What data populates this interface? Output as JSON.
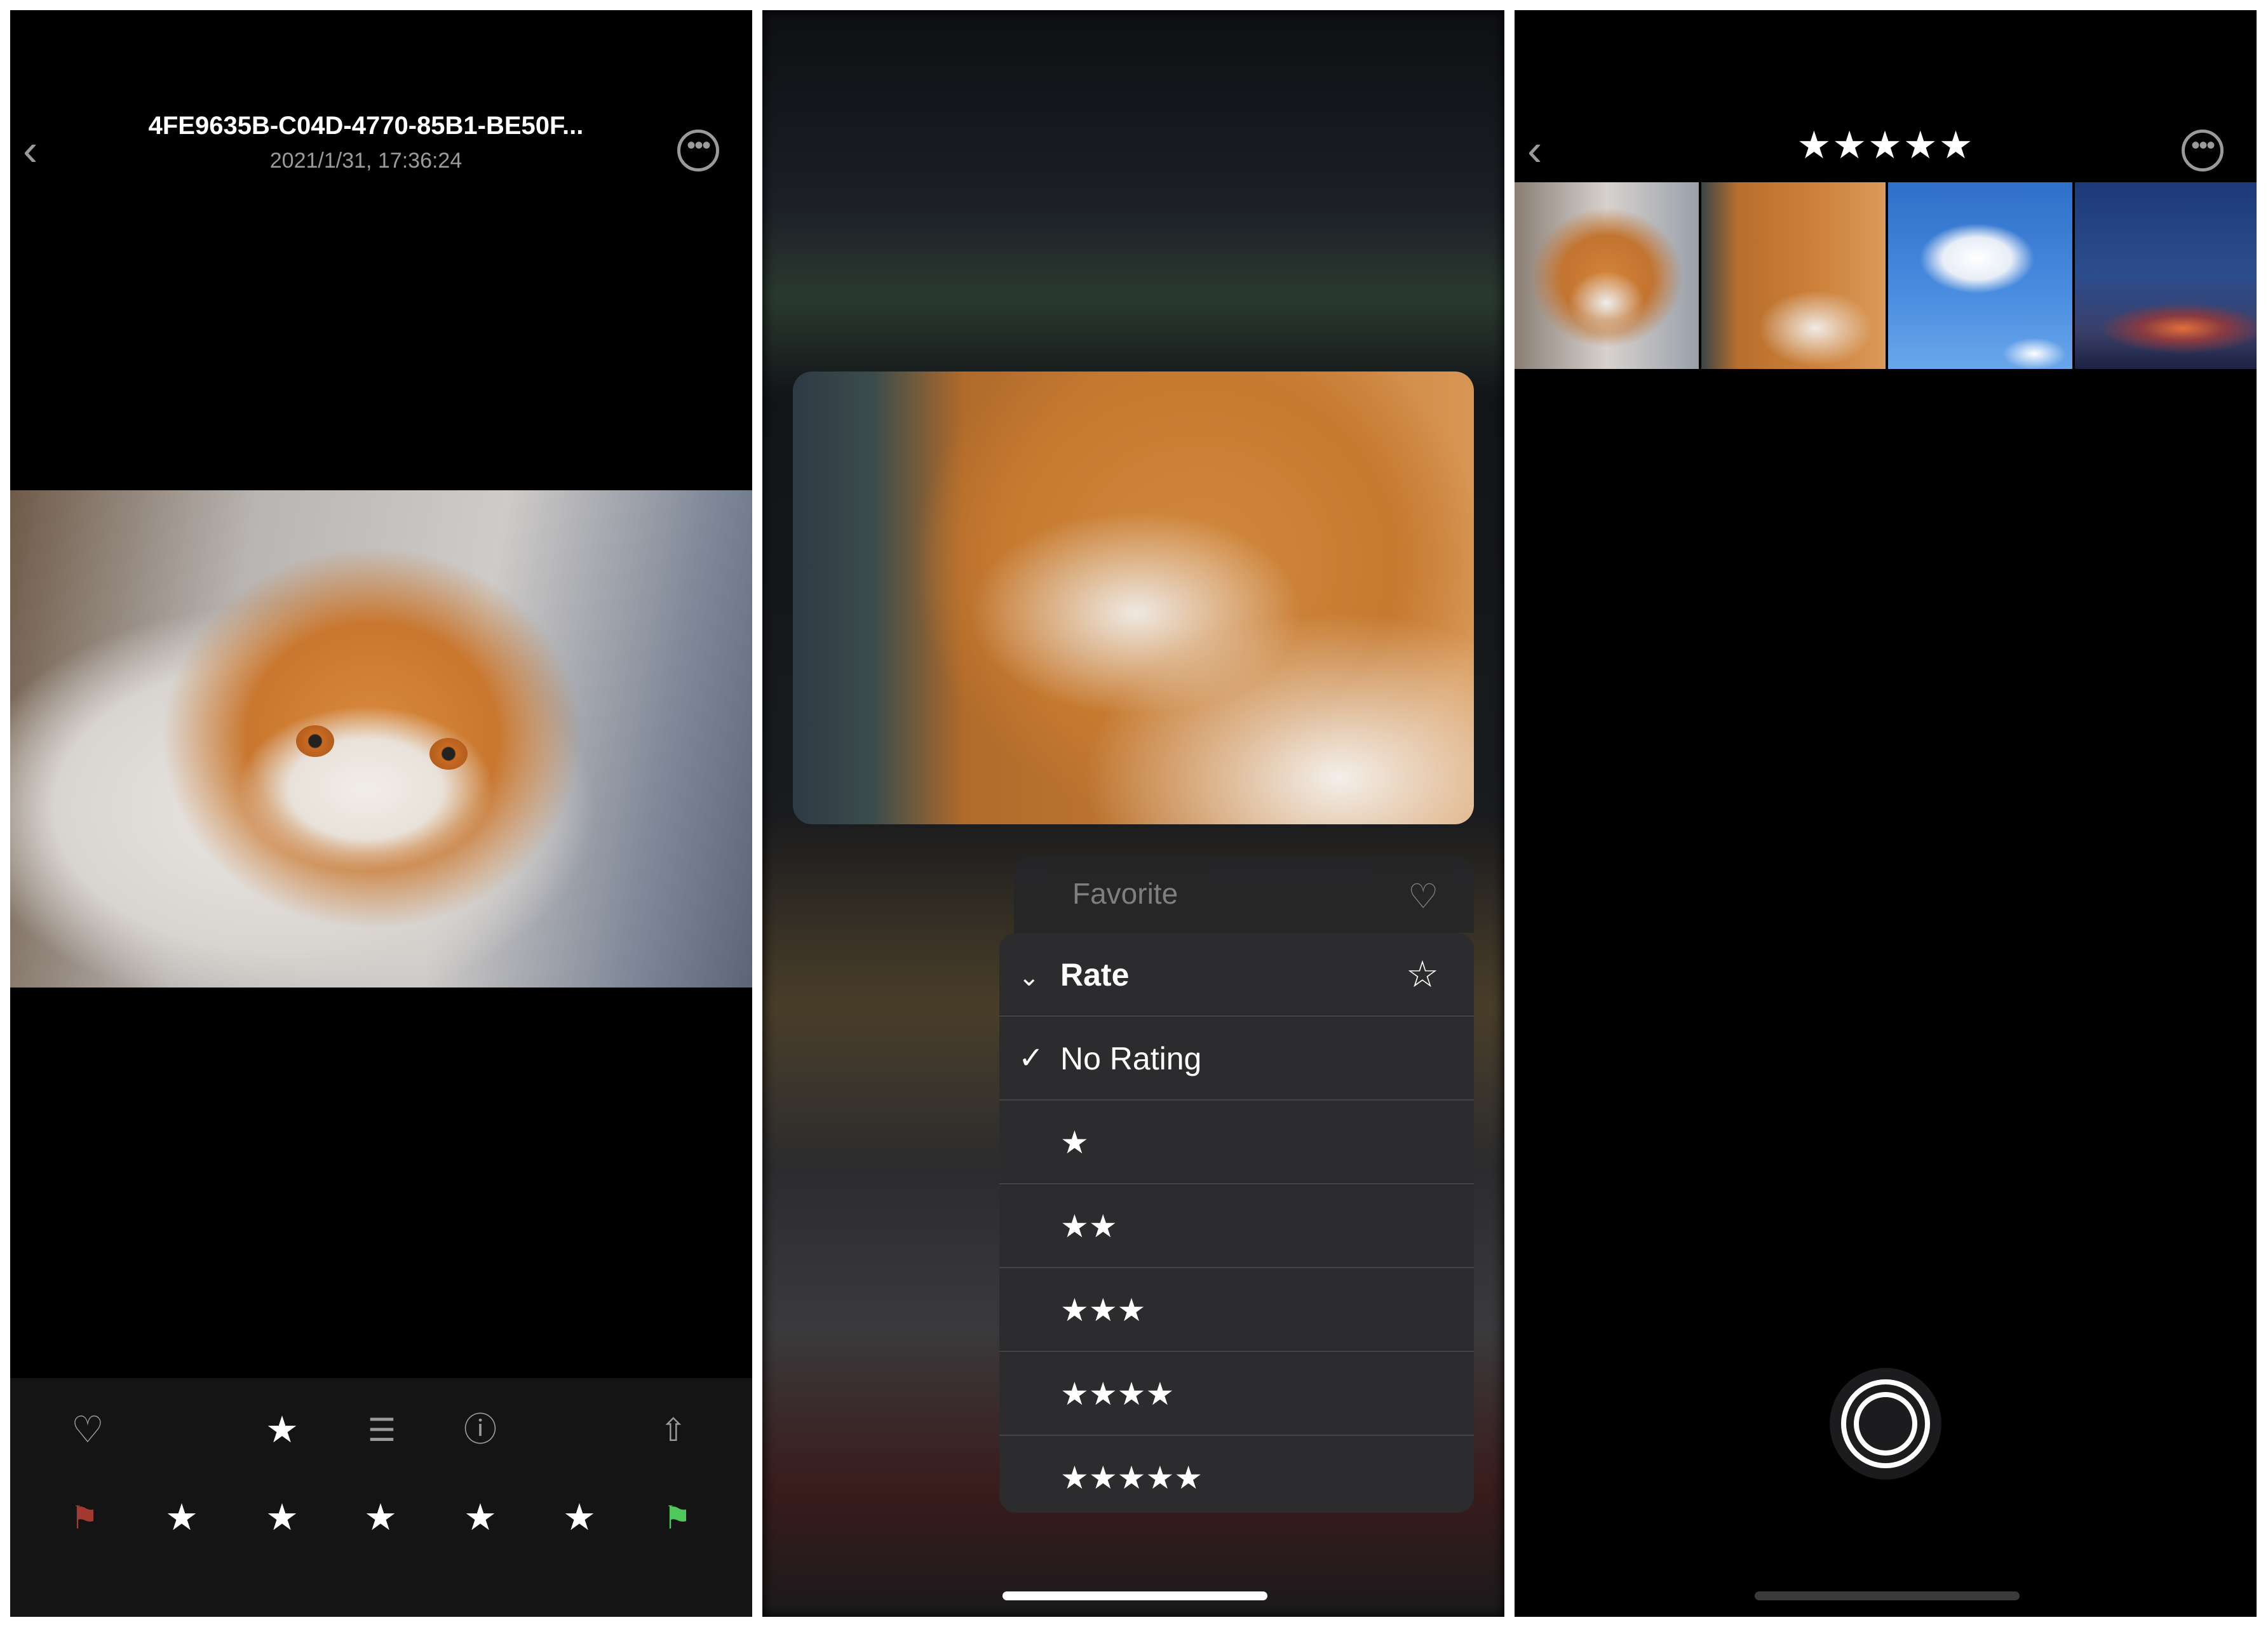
{
  "detail_screen": {
    "title": "4FE9635B-C04D-4770-85B1-BE50F...",
    "date": "2021/1/31, 17:36:24",
    "back_icon": "chevron-left-icon",
    "more_icon": "ellipsis-circle-icon",
    "toolbar": {
      "top_icons": [
        "heart-icon",
        "star-icon",
        "sliders-icon",
        "info-icon",
        "share-icon"
      ],
      "reject_flag_color": "#a33a32",
      "pick_flag_color": "#4fc95c",
      "rating_stars": 5
    }
  },
  "menu_screen": {
    "favorite_label": "Favorite",
    "rate_label": "Rate",
    "options": [
      "No Rating",
      "★",
      "★★",
      "★★★",
      "★★★★",
      "★★★★★"
    ],
    "selected_option": "No Rating"
  },
  "filter_screen": {
    "title": "★★★★★",
    "thumbnails": [
      "cat-face",
      "cat-fur",
      "clouds-sky",
      "sunset-sky"
    ]
  }
}
